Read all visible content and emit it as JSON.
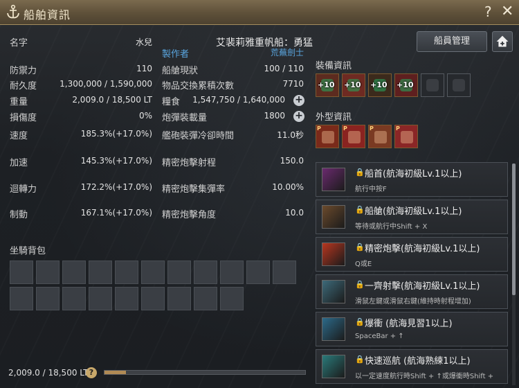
{
  "window": {
    "title": "船舶資訊",
    "help": "?",
    "close": "✕"
  },
  "stats_left": [
    {
      "label": "名字",
      "value": "水兒"
    },
    {
      "label": "防禦力",
      "value": "110"
    },
    {
      "label": "耐久度",
      "value": "1,300,000 / 1,590,000"
    },
    {
      "label": "重量",
      "value": "2,009.0 / 18,500 LT"
    },
    {
      "label": "損傷度",
      "value": "0%"
    },
    {
      "label": "速度",
      "value": "185.3%(+17.0%)"
    },
    {
      "label": "加速",
      "value": "145.3%(+17.0%)"
    },
    {
      "label": "迴轉力",
      "value": "172.2%(+17.0%)"
    },
    {
      "label": "制動",
      "value": "167.1%(+17.0%)"
    }
  ],
  "ship_type": "艾裴莉雅重帆船：勇猛",
  "maker": {
    "label": "製作者",
    "value": "荒蕪劍士"
  },
  "stats_right": [
    {
      "label": "船艙現狀",
      "value": "100 / 110"
    },
    {
      "label": "物品交換累積次數",
      "value": "7710"
    },
    {
      "label": "糧食",
      "value": "1,547,750 / 1,640,000"
    },
    {
      "label": "炮彈裝載量",
      "value": "1800"
    },
    {
      "label": "艦砲裝彈冷卻時間",
      "value": "11.0秒"
    },
    {
      "label": "精密炮擊射程",
      "value": "150.0"
    },
    {
      "label": "精密炮擊集彈率",
      "value": "10.00%"
    },
    {
      "label": "精密炮擊角度",
      "value": "10.0"
    }
  ],
  "buttons": {
    "crew": "船員管理",
    "plus": "+"
  },
  "equipment": {
    "title": "裝備資訊",
    "slots": [
      {
        "enhance": "+10",
        "icon": "figurehead-icon"
      },
      {
        "enhance": "+10",
        "icon": "plating-icon"
      },
      {
        "enhance": "+10",
        "icon": "cannon-icon"
      },
      {
        "enhance": "+10",
        "icon": "sail-icon"
      },
      {
        "enhance": "",
        "icon": "crew-slot-icon"
      },
      {
        "enhance": "",
        "icon": "tool-slot-icon"
      }
    ]
  },
  "appearance": {
    "title": "外型資訊",
    "slots": [
      {
        "badge": "P",
        "icon": "hull-paint-icon"
      },
      {
        "badge": "P",
        "icon": "cannon-paint-icon"
      },
      {
        "badge": "P",
        "icon": "mast-paint-icon"
      },
      {
        "badge": "P",
        "icon": "sail-paint-icon"
      }
    ]
  },
  "skills": [
    {
      "lock": "🔒",
      "name": "船首(航海初級Lv.1以上)",
      "desc": "航行中按F",
      "icon": "bow-ram-icon",
      "color": "#6a2a6e"
    },
    {
      "lock": "🔒",
      "name": "船艙(航海初級Lv.1以上)",
      "desc": "等待或航行中Shift + X",
      "icon": "cabin-icon",
      "color": "#6b4a2c"
    },
    {
      "lock": "🔒",
      "name": "精密炮擊(航海初級Lv.1以上)",
      "desc": "Q或E",
      "icon": "precision-fire-icon",
      "color": "#b8361f"
    },
    {
      "lock": "🔒",
      "name": "一齊射擊(航海初級Lv.1以上)",
      "desc": "滑鼠左鍵或滑鼠右鍵(維持時射程增加)",
      "icon": "volley-icon",
      "color": "#3d6a7a"
    },
    {
      "lock": "🔒",
      "name": "爆衝 (航海見習1以上)",
      "desc": "SpaceBar + ↑",
      "icon": "burst-icon",
      "color": "#2c6a8a"
    },
    {
      "lock": "🔒",
      "name": "快速巡航 (航海熟練1以上)",
      "desc": "以一定速度航行時Shift + ↑或爆衝時Shift +",
      "icon": "cruise-icon",
      "color": "#2a7a7a"
    }
  ],
  "mount_inventory": {
    "title": "坐騎背包",
    "slot_count": 20
  },
  "weight": {
    "text": "2,009.0 / 18,500 LT",
    "help": "?",
    "fill_fraction": 0.108
  },
  "colors": {
    "accent_gold": "#c7a76a",
    "maker_blue": "#5aa6e0"
  }
}
